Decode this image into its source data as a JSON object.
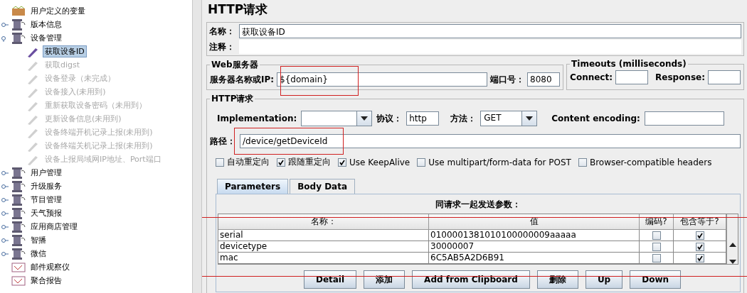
{
  "tree": [
    {
      "label": "用户定义的变量",
      "kind": "variables",
      "disabled": false,
      "selected": false
    },
    {
      "label": "版本信息",
      "kind": "controller",
      "disabled": false,
      "selected": false,
      "expanded": false
    },
    {
      "label": "设备管理",
      "kind": "controller",
      "disabled": false,
      "selected": false,
      "expanded": true,
      "children": [
        {
          "label": "获取设备ID",
          "kind": "sampler",
          "disabled": false,
          "selected": true
        },
        {
          "label": "获取digst",
          "kind": "sampler",
          "disabled": true,
          "selected": false
        },
        {
          "label": "设备登录（未完成）",
          "kind": "sampler",
          "disabled": true,
          "selected": false
        },
        {
          "label": "设备接入(未用到)",
          "kind": "sampler",
          "disabled": true,
          "selected": false
        },
        {
          "label": "重新获取设备密码（未用到）",
          "kind": "sampler",
          "disabled": true,
          "selected": false
        },
        {
          "label": "更新设备信息(未用到)",
          "kind": "sampler",
          "disabled": true,
          "selected": false
        },
        {
          "label": "设备终端开机记录上报(未用到)",
          "kind": "sampler",
          "disabled": true,
          "selected": false
        },
        {
          "label": "设备终端关机记录上报(未用到)",
          "kind": "sampler",
          "disabled": true,
          "selected": false
        },
        {
          "label": "设备上报局域网IP地址、Port端口",
          "kind": "sampler",
          "disabled": true,
          "selected": false
        }
      ]
    },
    {
      "label": "用户管理",
      "kind": "controller",
      "disabled": false,
      "selected": false,
      "expanded": false
    },
    {
      "label": "升级服务",
      "kind": "controller",
      "disabled": false,
      "selected": false,
      "expanded": false
    },
    {
      "label": " 节目管理",
      "kind": "controller",
      "disabled": false,
      "selected": false,
      "expanded": false
    },
    {
      "label": "天气预报",
      "kind": "controller",
      "disabled": false,
      "selected": false,
      "expanded": false
    },
    {
      "label": "应用商店管理",
      "kind": "controller",
      "disabled": false,
      "selected": false,
      "expanded": false
    },
    {
      "label": "智播",
      "kind": "controller",
      "disabled": false,
      "selected": false,
      "expanded": false
    },
    {
      "label": "微信",
      "kind": "controller",
      "disabled": false,
      "selected": false,
      "expanded": false
    },
    {
      "label": "邮件观察仪",
      "kind": "listener",
      "disabled": false,
      "selected": false
    },
    {
      "label": "聚合报告",
      "kind": "listener",
      "disabled": false,
      "selected": false
    }
  ],
  "panel": {
    "title": "HTTP请求",
    "name": {
      "label": "名称：",
      "value": "获取设备ID"
    },
    "comment": {
      "label": "注释："
    },
    "web_server": {
      "legend": "Web服务器",
      "server_label": "服务器名称或IP:",
      "server_value": "${domain}",
      "port_label": "端口号：",
      "port_value": "8080"
    },
    "timeouts": {
      "legend": "Timeouts (milliseconds)",
      "connect_label": "Connect:",
      "response_label": "Response:"
    },
    "http_request": {
      "legend": "HTTP请求",
      "implementation_label": "Implementation:",
      "protocol_label": "协议：",
      "protocol_value": "http",
      "method_label": "方法：",
      "method_value": "GET",
      "encoding_label": "Content encoding:",
      "path_label": "路径：",
      "path_value": "/device/getDeviceId"
    },
    "options": [
      {
        "label": "自动重定向",
        "checked": false
      },
      {
        "label": "跟随重定向",
        "checked": true
      },
      {
        "label": "Use KeepAlive",
        "checked": true
      },
      {
        "label": "Use multipart/form-data for POST",
        "checked": false
      },
      {
        "label": "Browser-compatible headers",
        "checked": false
      }
    ],
    "tabs": [
      {
        "label": "Parameters",
        "selected": true
      },
      {
        "label": "Body Data",
        "selected": false
      }
    ],
    "table": {
      "title": "同请求一起发送参数：",
      "columns": [
        "名称：",
        "值",
        "编码?",
        "包含等于?"
      ],
      "rows": [
        {
          "name": "serial",
          "value": "0100001381010100000009aaaaa",
          "encode": false,
          "include_equals": true
        },
        {
          "name": "devicetype",
          "value": "30000007",
          "encode": false,
          "include_equals": true
        },
        {
          "name": "mac",
          "value": "6C5AB5A2D6B91",
          "encode": false,
          "include_equals": true
        }
      ]
    },
    "buttons": [
      "Detail",
      "添加",
      "Add from Clipboard",
      "删除",
      "Up",
      "Down"
    ]
  }
}
